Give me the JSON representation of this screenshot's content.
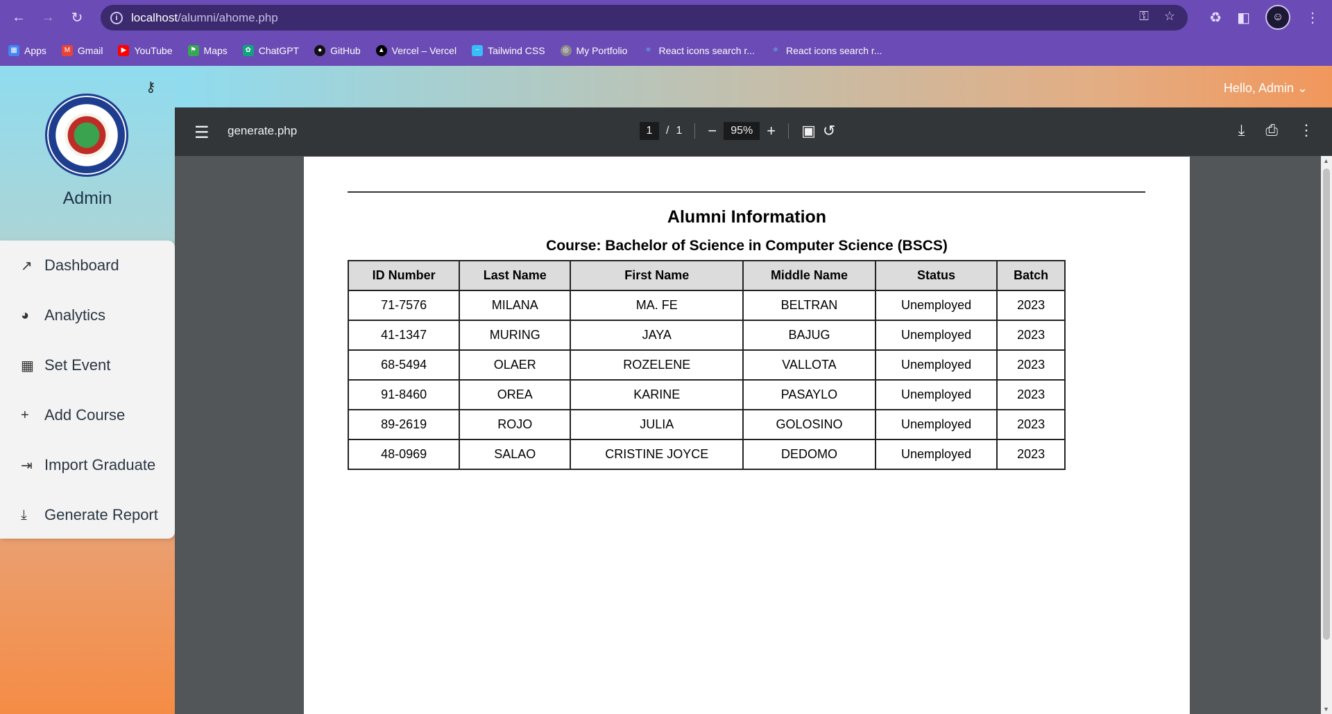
{
  "browser": {
    "url_host": "localhost",
    "url_path": "/alumni/ahome.php",
    "bookmarks": [
      "Apps",
      "Gmail",
      "YouTube",
      "Maps",
      "ChatGPT",
      "GitHub",
      "Vercel – Vercel",
      "Tailwind CSS",
      "My Portfolio",
      "React icons search r...",
      "React icons search r..."
    ]
  },
  "sidebar": {
    "user": "Admin",
    "items": [
      "Dashboard",
      "Analytics",
      "Set Event",
      "Add Course",
      "Import Graduate",
      "Generate Report"
    ]
  },
  "header": {
    "greeting": "Hello, Admin"
  },
  "pdf": {
    "filename": "generate.php",
    "page_current": "1",
    "page_sep": "/",
    "page_total": "1",
    "zoom": "95%",
    "doc": {
      "title": "Alumni Information",
      "course": "Course: Bachelor of Science in Computer Science (BSCS)",
      "columns": [
        "ID Number",
        "Last Name",
        "First Name",
        "Middle Name",
        "Status",
        "Batch"
      ],
      "rows": [
        [
          "71-7576",
          "MILANA",
          "MA. FE",
          "BELTRAN",
          "Unemployed",
          "2023"
        ],
        [
          "41-1347",
          "MURING",
          "JAYA",
          "BAJUG",
          "Unemployed",
          "2023"
        ],
        [
          "68-5494",
          "OLAER",
          "ROZELENE",
          "VALLOTA",
          "Unemployed",
          "2023"
        ],
        [
          "91-8460",
          "OREA",
          "KARINE",
          "PASAYLO",
          "Unemployed",
          "2023"
        ],
        [
          "89-2619",
          "ROJO",
          "JULIA",
          "GOLOSINO",
          "Unemployed",
          "2023"
        ],
        [
          "48-0969",
          "SALAO",
          "CRISTINE JOYCE",
          "DEDOMO",
          "Unemployed",
          "2023"
        ]
      ]
    }
  }
}
